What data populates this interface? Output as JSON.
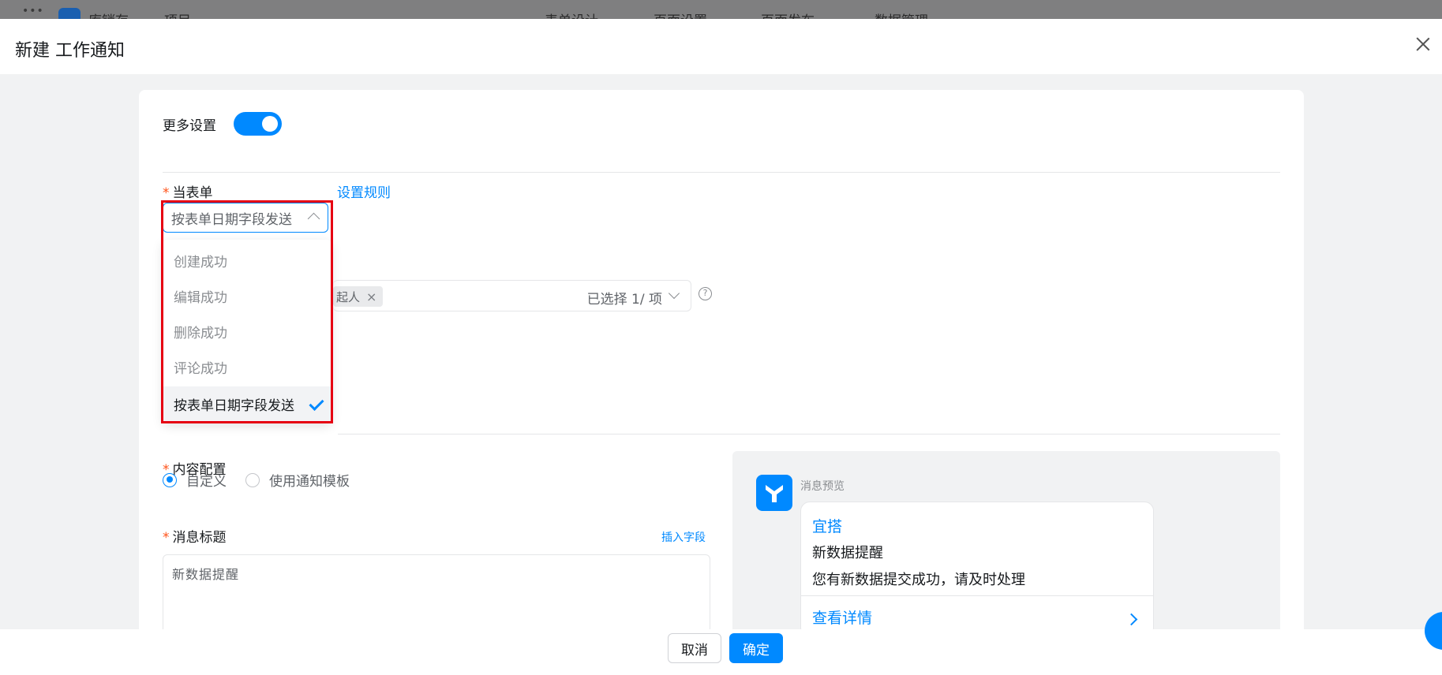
{
  "background_app": {
    "dots": "•••",
    "app_name": "库销存",
    "crumb": "项目",
    "nav": [
      "表单设计",
      "页面设置",
      "页面发布",
      "数据管理"
    ]
  },
  "modal": {
    "title": "新建 工作通知"
  },
  "more_settings": {
    "label": "更多设置",
    "enabled": true
  },
  "trigger": {
    "label": "当表单",
    "rule_link": "设置规则",
    "selected": "按表单日期字段发送",
    "options": [
      "创建成功",
      "编辑成功",
      "删除成功",
      "评论成功",
      "按表单日期字段发送"
    ]
  },
  "recipient": {
    "tag": "起人",
    "tag_remove": "×",
    "count_text": "已选择 1/ 项",
    "help": "?"
  },
  "content_config": {
    "label": "内容配置",
    "options": [
      "自定义",
      "使用通知模板"
    ],
    "selected": "自定义"
  },
  "message_title": {
    "label": "消息标题",
    "insert_field": "插入字段",
    "value": "新数据提醒"
  },
  "preview": {
    "label": "消息预览",
    "app": "宜搭",
    "title": "新数据提醒",
    "body": "您有新数据提交成功，请及时处理",
    "link": "查看详情"
  },
  "footer": {
    "cancel": "取消",
    "ok": "确定"
  },
  "colors": {
    "primary": "#0089ff",
    "required": "#ff5219",
    "highlight": "#e60012"
  }
}
